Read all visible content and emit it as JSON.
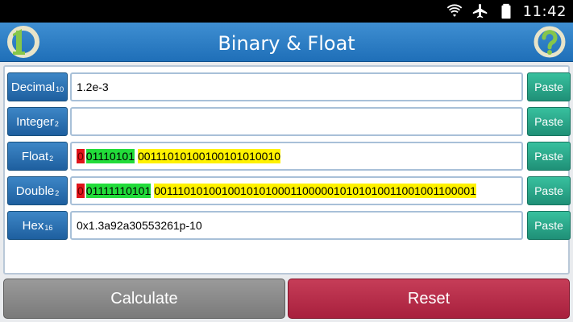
{
  "status_bar": {
    "time": "11:42",
    "icons": [
      "wifi-icon",
      "airplane-mode-icon",
      "battery-icon"
    ]
  },
  "header": {
    "title": "Binary & Float",
    "logo_text": "1D",
    "help_icon": "question-mark-icon"
  },
  "rows": [
    {
      "label": "Decimal",
      "base": "10",
      "value": "1.2e-3",
      "paste": "Paste"
    },
    {
      "label": "Integer",
      "base": "2",
      "value": "",
      "paste": "Paste"
    },
    {
      "label": "Float",
      "base": "2",
      "sign": "0",
      "exponent": "01110101",
      "mantissa": "00111010100100101010010",
      "paste": "Paste"
    },
    {
      "label": "Double",
      "base": "2",
      "sign": "0",
      "exponent": "01111110101",
      "mantissa": "0011101010010010101000110000010101010011001001100001",
      "paste": "Paste"
    },
    {
      "label": "Hex",
      "base": "16",
      "value": "0x1.3a92a30553261p-10",
      "paste": "Paste"
    }
  ],
  "buttons": {
    "calculate": "Calculate",
    "reset": "Reset"
  },
  "colors": {
    "header": "#2a7cc3",
    "label_button": "#2d73b3",
    "paste_button": "#2aa888",
    "calculate_button": "#8a8a8a",
    "reset_button": "#b72e4a",
    "sign_bit": "#e0151b",
    "exponent_bits": "#22dc3a",
    "mantissa_bits": "#fff200"
  }
}
